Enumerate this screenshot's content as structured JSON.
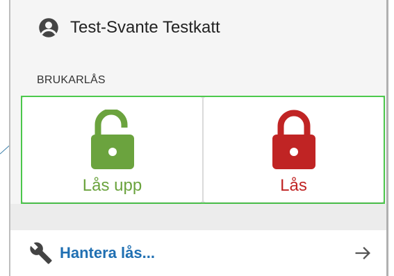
{
  "user": {
    "name": "Test-Svante Testkatt",
    "icon": "account-circle-icon"
  },
  "section": {
    "label": "BRUKARLÅS"
  },
  "locks": {
    "unlock": {
      "label": "Lås upp",
      "icon": "lock-open-icon",
      "color": "#6ba33e"
    },
    "lock": {
      "label": "Lås",
      "icon": "lock-closed-icon",
      "color": "#c02424"
    }
  },
  "manage": {
    "label": "Hantera lås...",
    "icon": "wrench-icon",
    "arrow": "arrow-right-icon"
  },
  "colors": {
    "highlight_border": "#4cc94c",
    "link": "#1f6fb2"
  }
}
